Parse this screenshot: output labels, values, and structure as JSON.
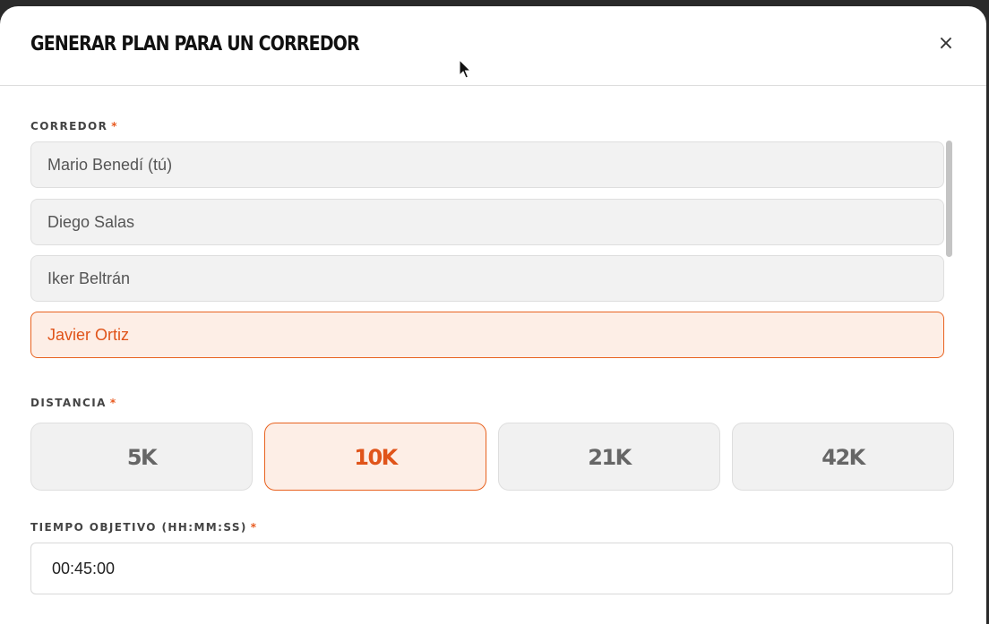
{
  "modal": {
    "title": "GENERAR PLAN PARA UN CORREDOR",
    "close_label": "×"
  },
  "runner_field": {
    "label": "CORREDOR",
    "required_mark": "*",
    "options": [
      {
        "label": "Mario Benedí (tú)",
        "selected": false
      },
      {
        "label": "Diego Salas",
        "selected": false
      },
      {
        "label": "Iker Beltrán",
        "selected": false
      },
      {
        "label": "Javier Ortiz",
        "selected": true
      }
    ]
  },
  "distance_field": {
    "label": "DISTANCIA",
    "required_mark": "*",
    "options": [
      {
        "label": "5K",
        "selected": false
      },
      {
        "label": "10K",
        "selected": true
      },
      {
        "label": "21K",
        "selected": false
      },
      {
        "label": "42K",
        "selected": false
      }
    ]
  },
  "target_time_field": {
    "label": "TIEMPO OBJETIVO (HH:MM:SS)",
    "required_mark": "*",
    "value": "00:45:00"
  },
  "colors": {
    "accent": "#e8621f",
    "accent_bg": "#fdeee6",
    "option_bg": "#f2f2f2"
  }
}
